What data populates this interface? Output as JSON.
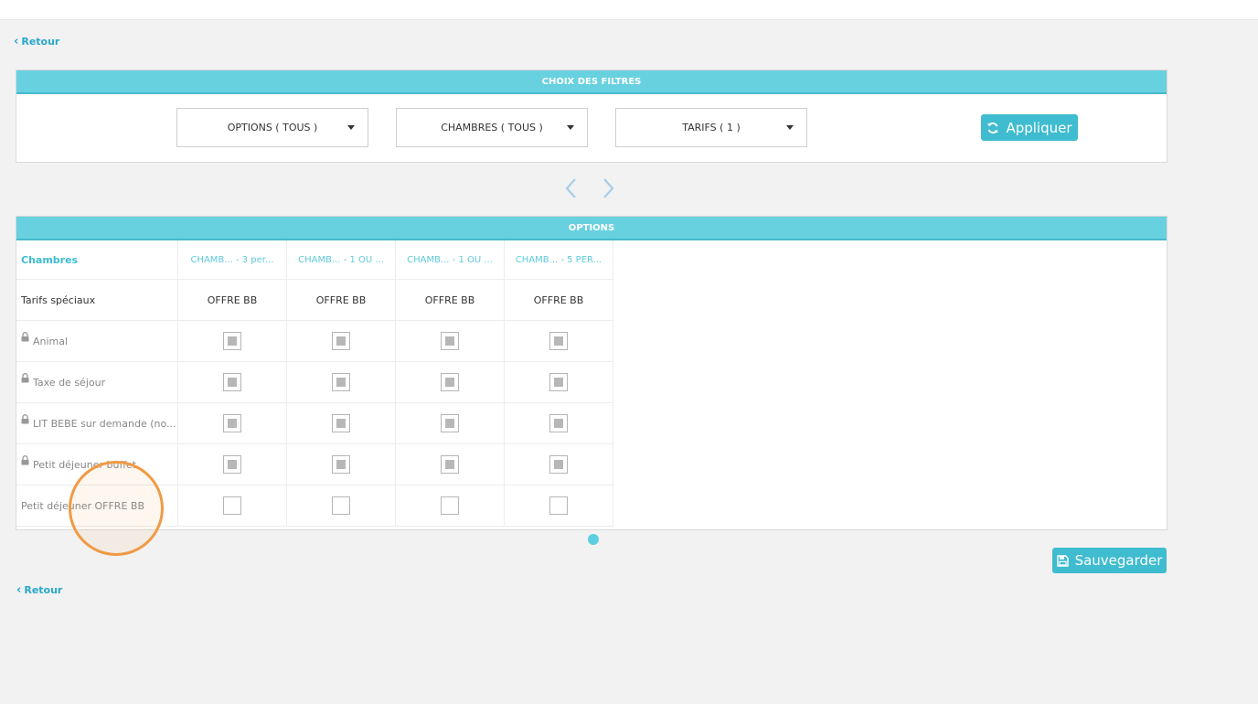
{
  "nav": {
    "back_label": "Retour"
  },
  "filters": {
    "header": "CHOIX DES FILTRES",
    "options_label": "OPTIONS ( TOUS )",
    "chambres_label": "CHAMBRES ( TOUS )",
    "tarifs_label": "TARIFS ( 1 )",
    "apply_label": "Appliquer"
  },
  "options": {
    "header": "OPTIONS",
    "first_col_header": "Chambres",
    "rooms": [
      "CHAMB... - 3 per...",
      "CHAMB... - 1 OU ...",
      "CHAMB... - 1 OU ...",
      "CHAMB... - 5 PER..."
    ],
    "tarifs_label": "Tarifs spéciaux",
    "tarifs": [
      "OFFRE BB",
      "OFFRE BB",
      "OFFRE BB",
      "OFFRE BB"
    ],
    "rows": [
      {
        "label": "Animal",
        "locked": true,
        "checked": [
          true,
          true,
          true,
          true
        ]
      },
      {
        "label": "Taxe de séjour",
        "locked": true,
        "checked": [
          true,
          true,
          true,
          true
        ]
      },
      {
        "label": "LIT BEBE sur demande (no...",
        "locked": true,
        "checked": [
          true,
          true,
          true,
          true
        ]
      },
      {
        "label": "Petit déjeuner buffet",
        "locked": true,
        "checked": [
          true,
          true,
          true,
          true
        ]
      },
      {
        "label": "Petit déjeuner OFFRE BB",
        "locked": false,
        "checked": [
          false,
          false,
          false,
          false
        ]
      }
    ]
  },
  "actions": {
    "save_label": "Sauvegarder"
  },
  "colors": {
    "accent": "#3fbccf",
    "header": "#68d1e0",
    "link": "#29a9c9",
    "cursor_ring": "#f09a44"
  }
}
